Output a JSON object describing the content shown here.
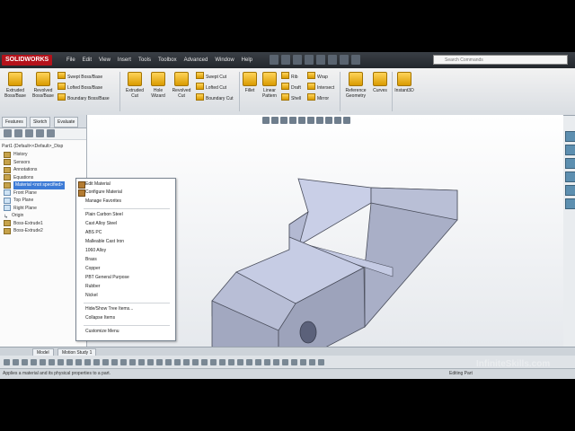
{
  "app": {
    "logo": "SOLIDWORKS"
  },
  "menu": [
    "File",
    "Edit",
    "View",
    "Insert",
    "Tools",
    "Toolbox",
    "Advanced",
    "Window",
    "Help"
  ],
  "search": {
    "placeholder": "Search Commands"
  },
  "ribbon": {
    "big": [
      {
        "label": "Extruded\nBoss/Base"
      },
      {
        "label": "Revolved\nBoss/Base"
      },
      {
        "label": "Extruded\nCut"
      },
      {
        "label": "Hole\nWizard"
      },
      {
        "label": "Revolved\nCut"
      },
      {
        "label": "Fillet"
      },
      {
        "label": "Linear\nPattern"
      },
      {
        "label": "Reference\nGeometry"
      },
      {
        "label": "Curves"
      },
      {
        "label": "Instant3D"
      }
    ],
    "small_col1": [
      "Swept Boss/Base",
      "Lofted Boss/Base",
      "Boundary Boss/Base"
    ],
    "small_col2": [
      "Swept Cut",
      "Lofted Cut",
      "Boundary Cut"
    ],
    "small_col3": [
      "Rib",
      "Draft",
      "Shell"
    ],
    "small_col4": [
      "Wrap",
      "Intersect",
      "Mirror"
    ]
  },
  "panel": {
    "tabs": [
      "Features",
      "Sketch",
      "Evaluate"
    ],
    "root": "Part1 (Default<<Default>_Disp",
    "items": [
      {
        "label": "History",
        "icon": "folder-icon"
      },
      {
        "label": "Sensors",
        "icon": "folder-icon"
      },
      {
        "label": "Annotations",
        "icon": "folder-icon"
      },
      {
        "label": "Equations",
        "icon": "folder-icon"
      },
      {
        "label": "Material <not specified>",
        "icon": "material-icon",
        "selected": true
      },
      {
        "label": "Front Plane",
        "icon": "plane-icon"
      },
      {
        "label": "Top Plane",
        "icon": "plane-icon"
      },
      {
        "label": "Right Plane",
        "icon": "plane-icon"
      },
      {
        "label": "Origin",
        "icon": "origin-icon"
      },
      {
        "label": "Boss-Extrude1",
        "icon": "feature-icon"
      },
      {
        "label": "Boss-Extrude2",
        "icon": "feature-icon"
      }
    ]
  },
  "context_menu": {
    "group1": [
      "Edit Material",
      "Configure Material",
      "Manage Favorites"
    ],
    "group2": [
      "Plain Carbon Steel",
      "Cast Alloy Steel",
      "ABS PC",
      "Malleable Cast Iron",
      "1060 Alloy",
      "Brass",
      "Copper",
      "PBT General Purpose",
      "Rubber",
      "Nickel"
    ],
    "group3": [
      "Hide/Show Tree Items...",
      "Collapse Items"
    ],
    "group4": [
      "Customize Menu"
    ]
  },
  "bottom_tabs": [
    "Model",
    "Motion Study 1"
  ],
  "status": {
    "message": "Applies a material and its physical properties to a part.",
    "mode": "Editing Part"
  },
  "watermark": "InfiniteSkills.com",
  "colors": {
    "selection": "#3d7bd6",
    "part": "#c9cfe6"
  }
}
